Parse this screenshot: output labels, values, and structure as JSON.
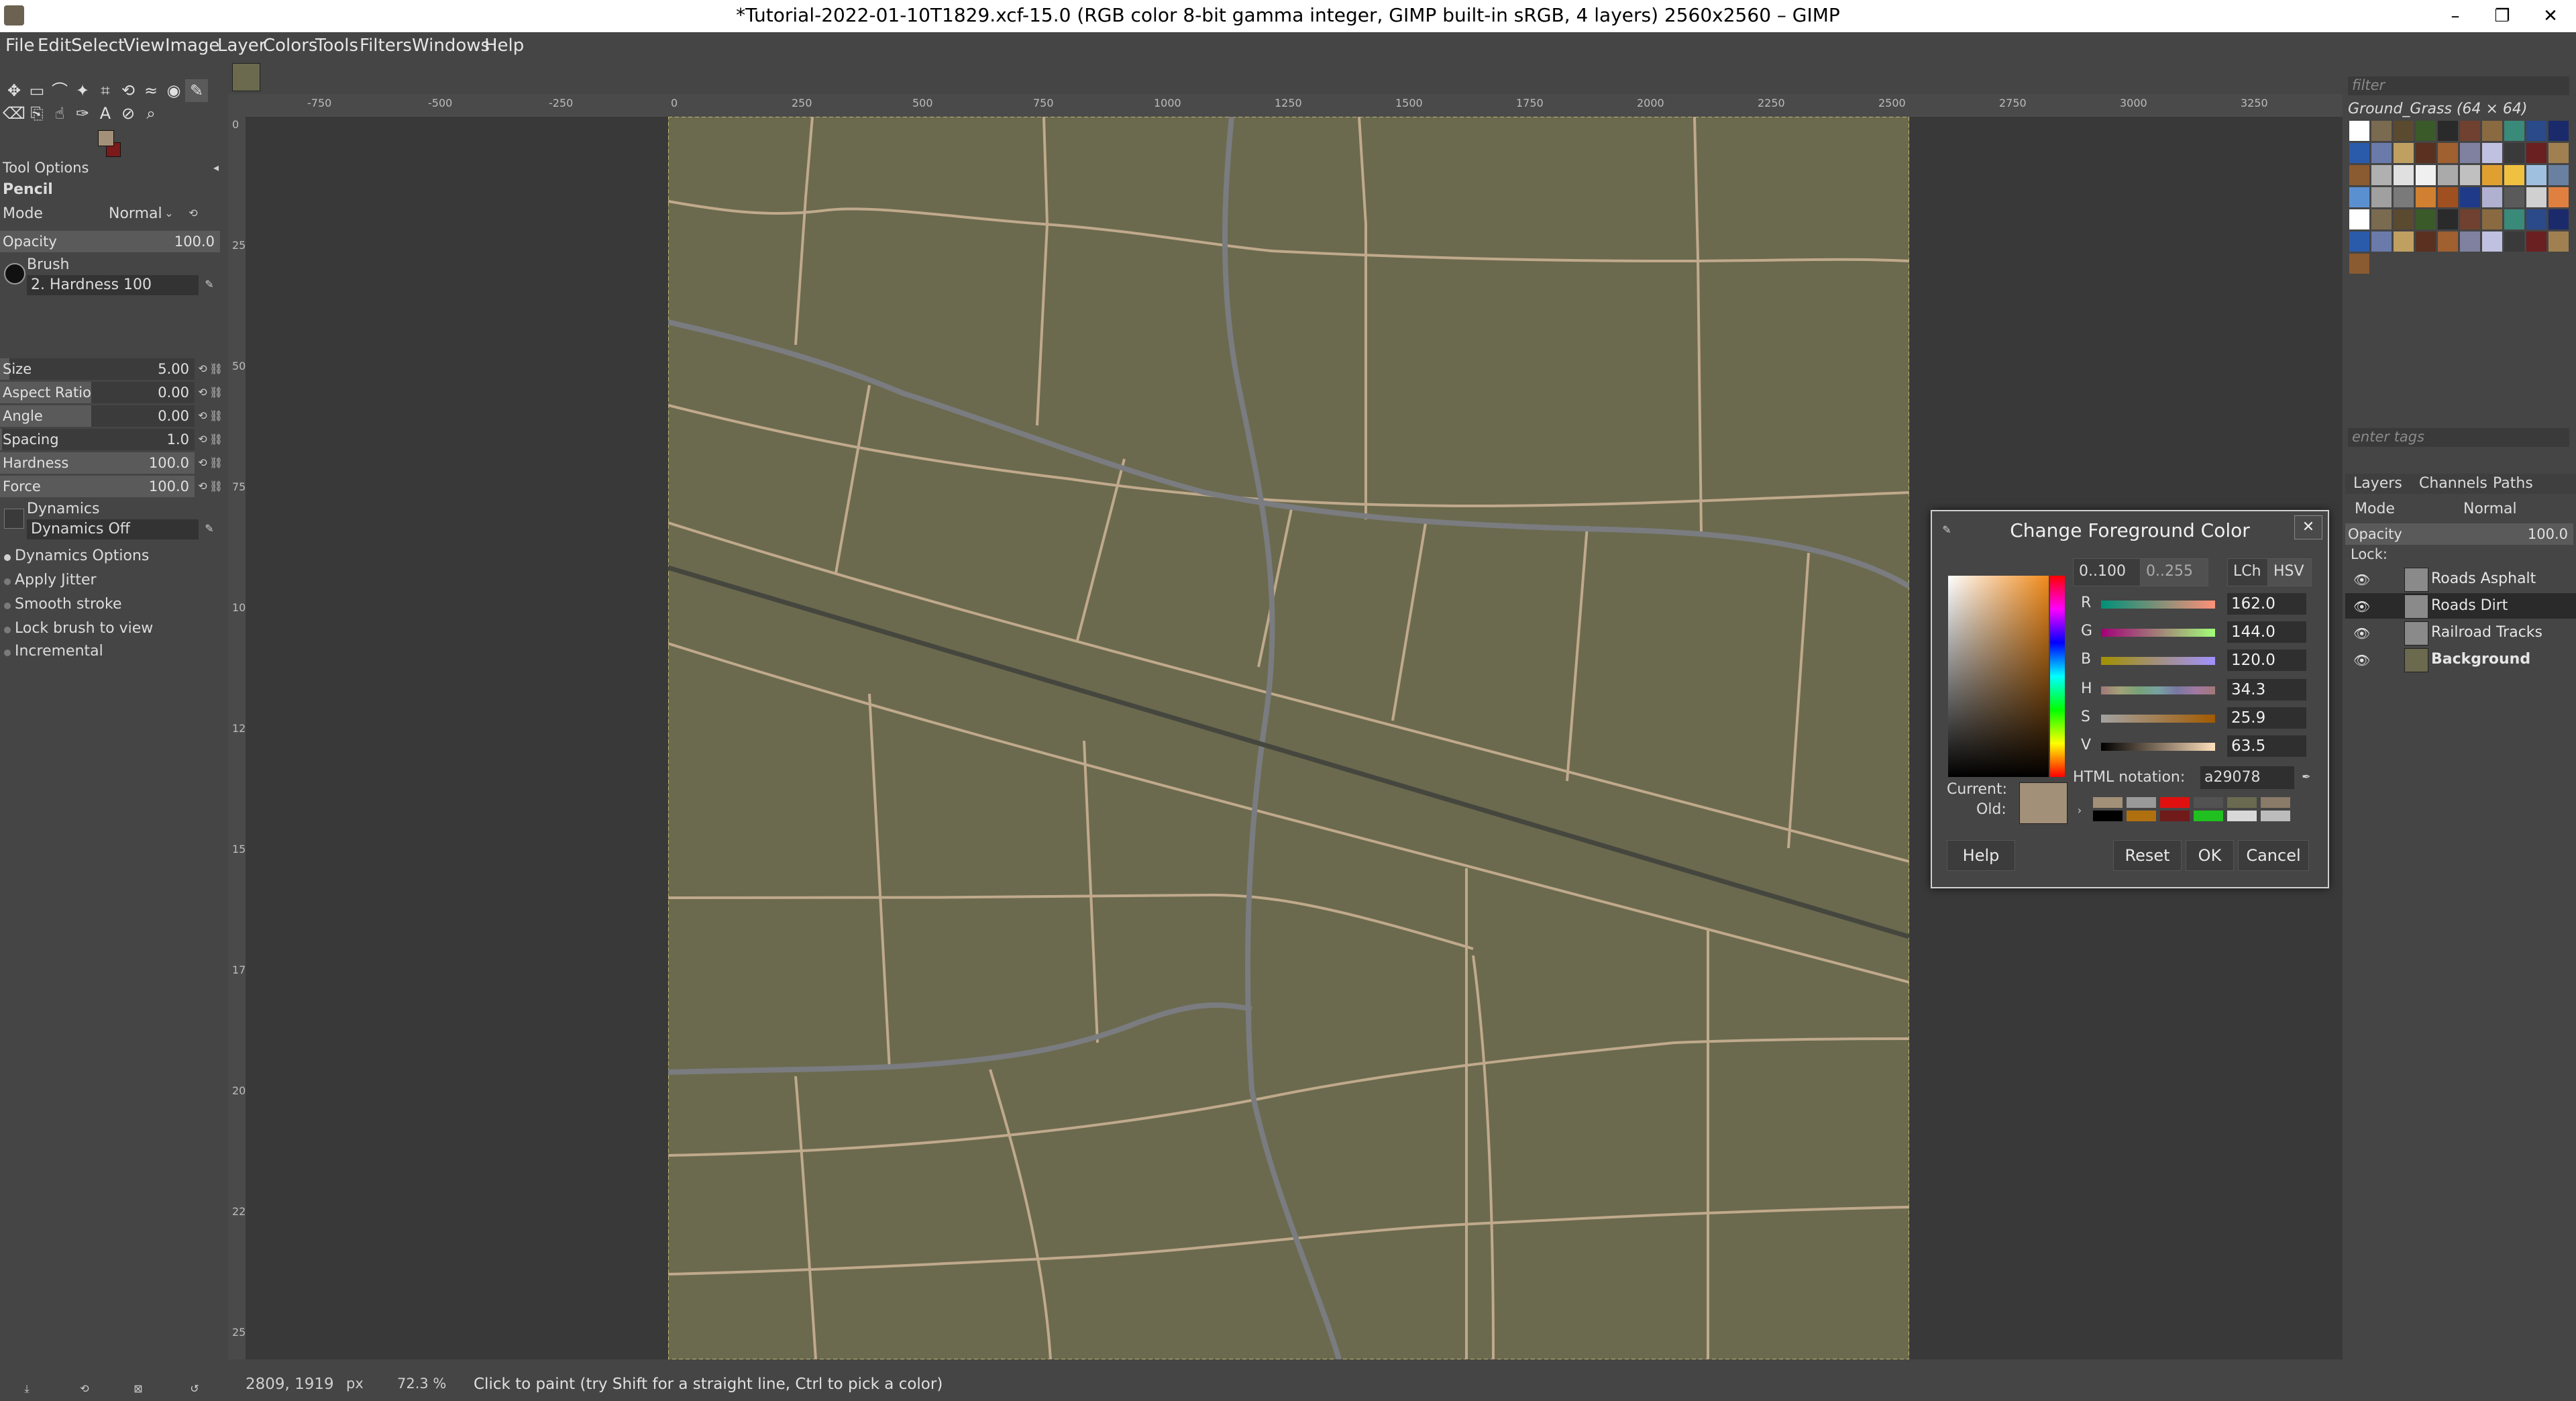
{
  "window": {
    "title": "*Tutorial-2022-01-10T1829.xcf-15.0 (RGB color 8-bit gamma integer, GIMP built-in sRGB, 4 layers) 2560x2560 – GIMP",
    "minimize": "–",
    "maximize": "❐",
    "close": "✕"
  },
  "menu": [
    "File",
    "Edit",
    "Select",
    "View",
    "Image",
    "Layer",
    "Colors",
    "Tools",
    "Filters",
    "Windows",
    "Help"
  ],
  "tool_options": {
    "header": "Tool Options",
    "tool_name": "Pencil",
    "mode_label": "Mode",
    "mode_value": "Normal",
    "opacity": {
      "label": "Opacity",
      "value": "100.0",
      "fraction": 1.0
    },
    "brush_label": "Brush",
    "brush_value": "2. Hardness 100",
    "size": {
      "label": "Size",
      "value": "5.00",
      "fraction": 0.05
    },
    "aspect_ratio": {
      "label": "Aspect Ratio",
      "value": "0.00",
      "fraction": 0.5
    },
    "angle": {
      "label": "Angle",
      "value": "0.00",
      "fraction": 0.5
    },
    "spacing": {
      "label": "Spacing",
      "value": "1.0",
      "fraction": 0.01
    },
    "hardness": {
      "label": "Hardness",
      "value": "100.0",
      "fraction": 1.0
    },
    "force": {
      "label": "Force",
      "value": "100.0",
      "fraction": 1.0
    },
    "dynamics_label": "Dynamics",
    "dynamics_value": "Dynamics Off",
    "dynamics_options": "Dynamics Options",
    "apply_jitter": "Apply Jitter",
    "smooth_stroke": "Smooth stroke",
    "lock_brush": "Lock brush to view",
    "incremental": "Incremental"
  },
  "ruler_h": [
    "-750",
    "-500",
    "-250",
    "0",
    "250",
    "500",
    "750",
    "1000",
    "1250",
    "1500",
    "1750",
    "2000",
    "2250",
    "2500",
    "2750",
    "3000",
    "3250"
  ],
  "ruler_v": [
    "0",
    "250",
    "500",
    "750",
    "1000",
    "1250",
    "1500",
    "1750",
    "2000",
    "2250",
    "2500"
  ],
  "status": {
    "coords": "2809, 1919",
    "unit": "px",
    "zoom": "72.3 %",
    "message": "Click to paint (try Shift for a straight line, Ctrl to pick a color)"
  },
  "patterns": {
    "filter_placeholder": "filter",
    "name": "Ground_Grass (64 × 64)",
    "tags_placeholder": "enter tags"
  },
  "layers_panel": {
    "tabs": [
      "Layers",
      "Channels",
      "Paths"
    ],
    "mode_label": "Mode",
    "mode_value": "Normal",
    "opacity_label": "Opacity",
    "opacity_value": "100.0",
    "lock_label": "Lock:",
    "layers": [
      {
        "name": "Roads Asphalt"
      },
      {
        "name": "Roads Dirt"
      },
      {
        "name": "Railroad Tracks"
      },
      {
        "name": "Background"
      }
    ]
  },
  "dialog": {
    "title": "Change Foreground Color",
    "range_100": "0..100",
    "range_255": "0..255",
    "lch": "LCh",
    "hsv": "HSV",
    "channels": [
      {
        "label": "R",
        "value": "162.0",
        "fraction": 0.635
      },
      {
        "label": "G",
        "value": "144.0",
        "fraction": 0.565
      },
      {
        "label": "B",
        "value": "120.0",
        "fraction": 0.471
      },
      {
        "label": "H",
        "value": "34.3",
        "fraction": 0.095
      },
      {
        "label": "S",
        "value": "25.9",
        "fraction": 0.259
      },
      {
        "label": "V",
        "value": "63.5",
        "fraction": 0.635
      }
    ],
    "html_label": "HTML notation:",
    "html_value": "a29078",
    "current_label": "Current:",
    "old_label": "Old:",
    "help": "Help",
    "reset": "Reset",
    "ok": "OK",
    "cancel": "Cancel"
  },
  "colors": {
    "foreground": "#a29078",
    "background": "#7a1a1a",
    "canvas_bg": "#6b6a4e",
    "dirt_road": "#c0a98c",
    "asphalt_road": "#7a7c80",
    "railroad": "#45463e"
  }
}
